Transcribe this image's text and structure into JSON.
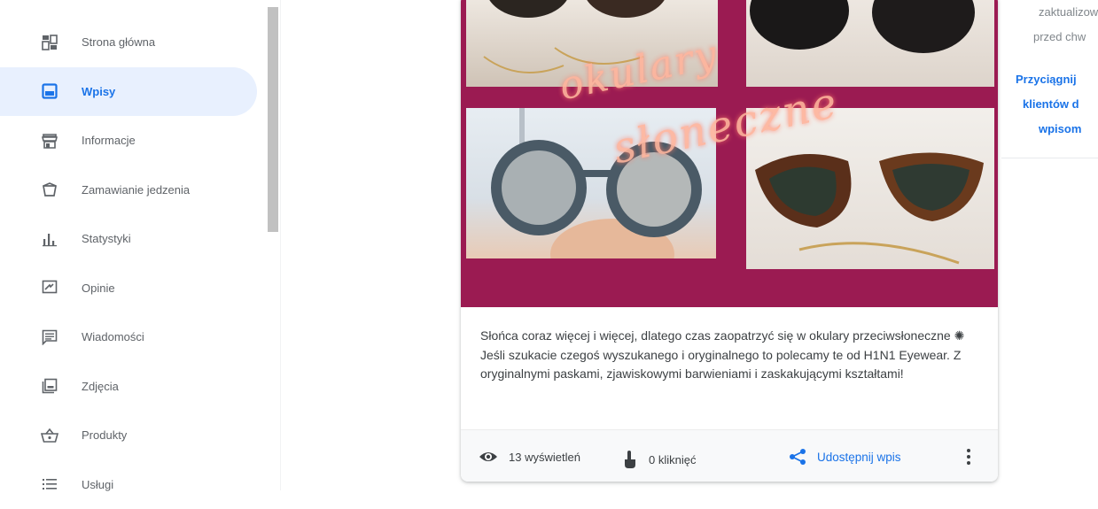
{
  "sidebar": {
    "items": [
      {
        "label": "Strona główna",
        "icon": "dashboard-icon",
        "active": false
      },
      {
        "label": "Wpisy",
        "icon": "posts-icon",
        "active": true
      },
      {
        "label": "Informacje",
        "icon": "storefront-icon",
        "active": false
      },
      {
        "label": "Zamawianie jedzenia",
        "icon": "food-order-icon",
        "active": false
      },
      {
        "label": "Statystyki",
        "icon": "bar-chart-icon",
        "active": false
      },
      {
        "label": "Opinie",
        "icon": "reviews-icon",
        "active": false
      },
      {
        "label": "Wiadomości",
        "icon": "messages-icon",
        "active": false
      },
      {
        "label": "Zdjęcia",
        "icon": "photos-icon",
        "active": false
      },
      {
        "label": "Produkty",
        "icon": "basket-icon",
        "active": false
      },
      {
        "label": "Usługi",
        "icon": "list-icon",
        "active": false
      }
    ]
  },
  "post": {
    "image_script_line1": "okulary",
    "image_script_line2": "słoneczne",
    "description": "Słońca coraz więcej i więcej, dlatego czas zaopatrzyć się w okulary przeciwsłoneczne ✺ Jeśli szukacie czegoś wyszukanego i oryginalnego to polecamy te od H1N1 Eyewear. Z oryginalnymi paskami, zjawiskowymi barwieniami i zaskakującymi kształtami!",
    "views": "13 wyświetleń",
    "clicks": "0 kliknięć",
    "share_label": "Udostępnij wpis"
  },
  "right_panel": {
    "line1": "zaktualizow",
    "line2": "przed chw",
    "link1": "Przyciągnij",
    "link2": "klientów d",
    "link3": "wpisom"
  },
  "colors": {
    "accent": "#1a73e8",
    "active_bg": "#e8f0fe",
    "photo_bg": "#9b1b52"
  }
}
